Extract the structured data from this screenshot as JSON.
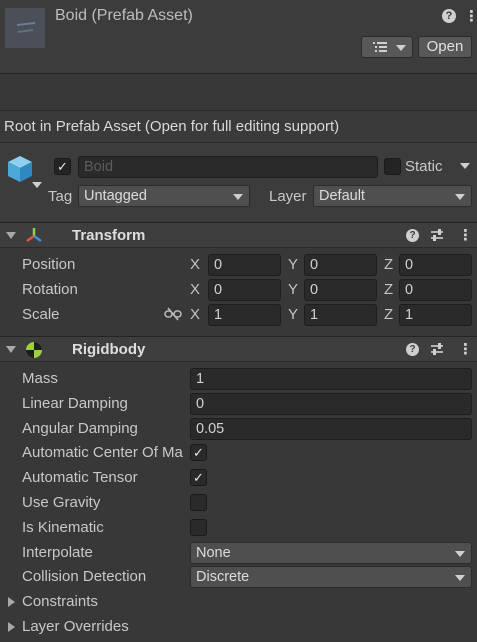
{
  "header": {
    "title": "Boid (Prefab Asset)",
    "help_icon": "help-icon",
    "menu_icon": "kebab-menu-icon",
    "open_button": "Open",
    "overrides_icon": "list-icon"
  },
  "info_bar": {
    "text": "Root in Prefab Asset (Open for full editing support)"
  },
  "gameobject": {
    "active": true,
    "name": "Boid",
    "static_label": "Static",
    "static": false,
    "tag_label": "Tag",
    "tag_value": "Untagged",
    "layer_label": "Layer",
    "layer_value": "Default"
  },
  "transform": {
    "title": "Transform",
    "rows": [
      {
        "label": "Position",
        "x": "0",
        "y": "0",
        "z": "0"
      },
      {
        "label": "Rotation",
        "x": "0",
        "y": "0",
        "z": "0"
      },
      {
        "label": "Scale",
        "x": "1",
        "y": "1",
        "z": "1"
      }
    ],
    "axis_x": "X",
    "axis_y": "Y",
    "axis_z": "Z"
  },
  "rigidbody": {
    "title": "Rigidbody",
    "mass_label": "Mass",
    "mass": "1",
    "linear_damping_label": "Linear Damping",
    "linear_damping": "0",
    "angular_damping_label": "Angular Damping",
    "angular_damping": "0.05",
    "auto_com_label": "Automatic Center Of Ma",
    "auto_com": true,
    "auto_tensor_label": "Automatic Tensor",
    "auto_tensor": true,
    "use_gravity_label": "Use Gravity",
    "use_gravity": false,
    "is_kinematic_label": "Is Kinematic",
    "is_kinematic": false,
    "interpolate_label": "Interpolate",
    "interpolate": "None",
    "collision_label": "Collision Detection",
    "collision": "Discrete",
    "constraints_label": "Constraints",
    "layer_overrides_label": "Layer Overrides"
  },
  "check_glyph": "✓"
}
